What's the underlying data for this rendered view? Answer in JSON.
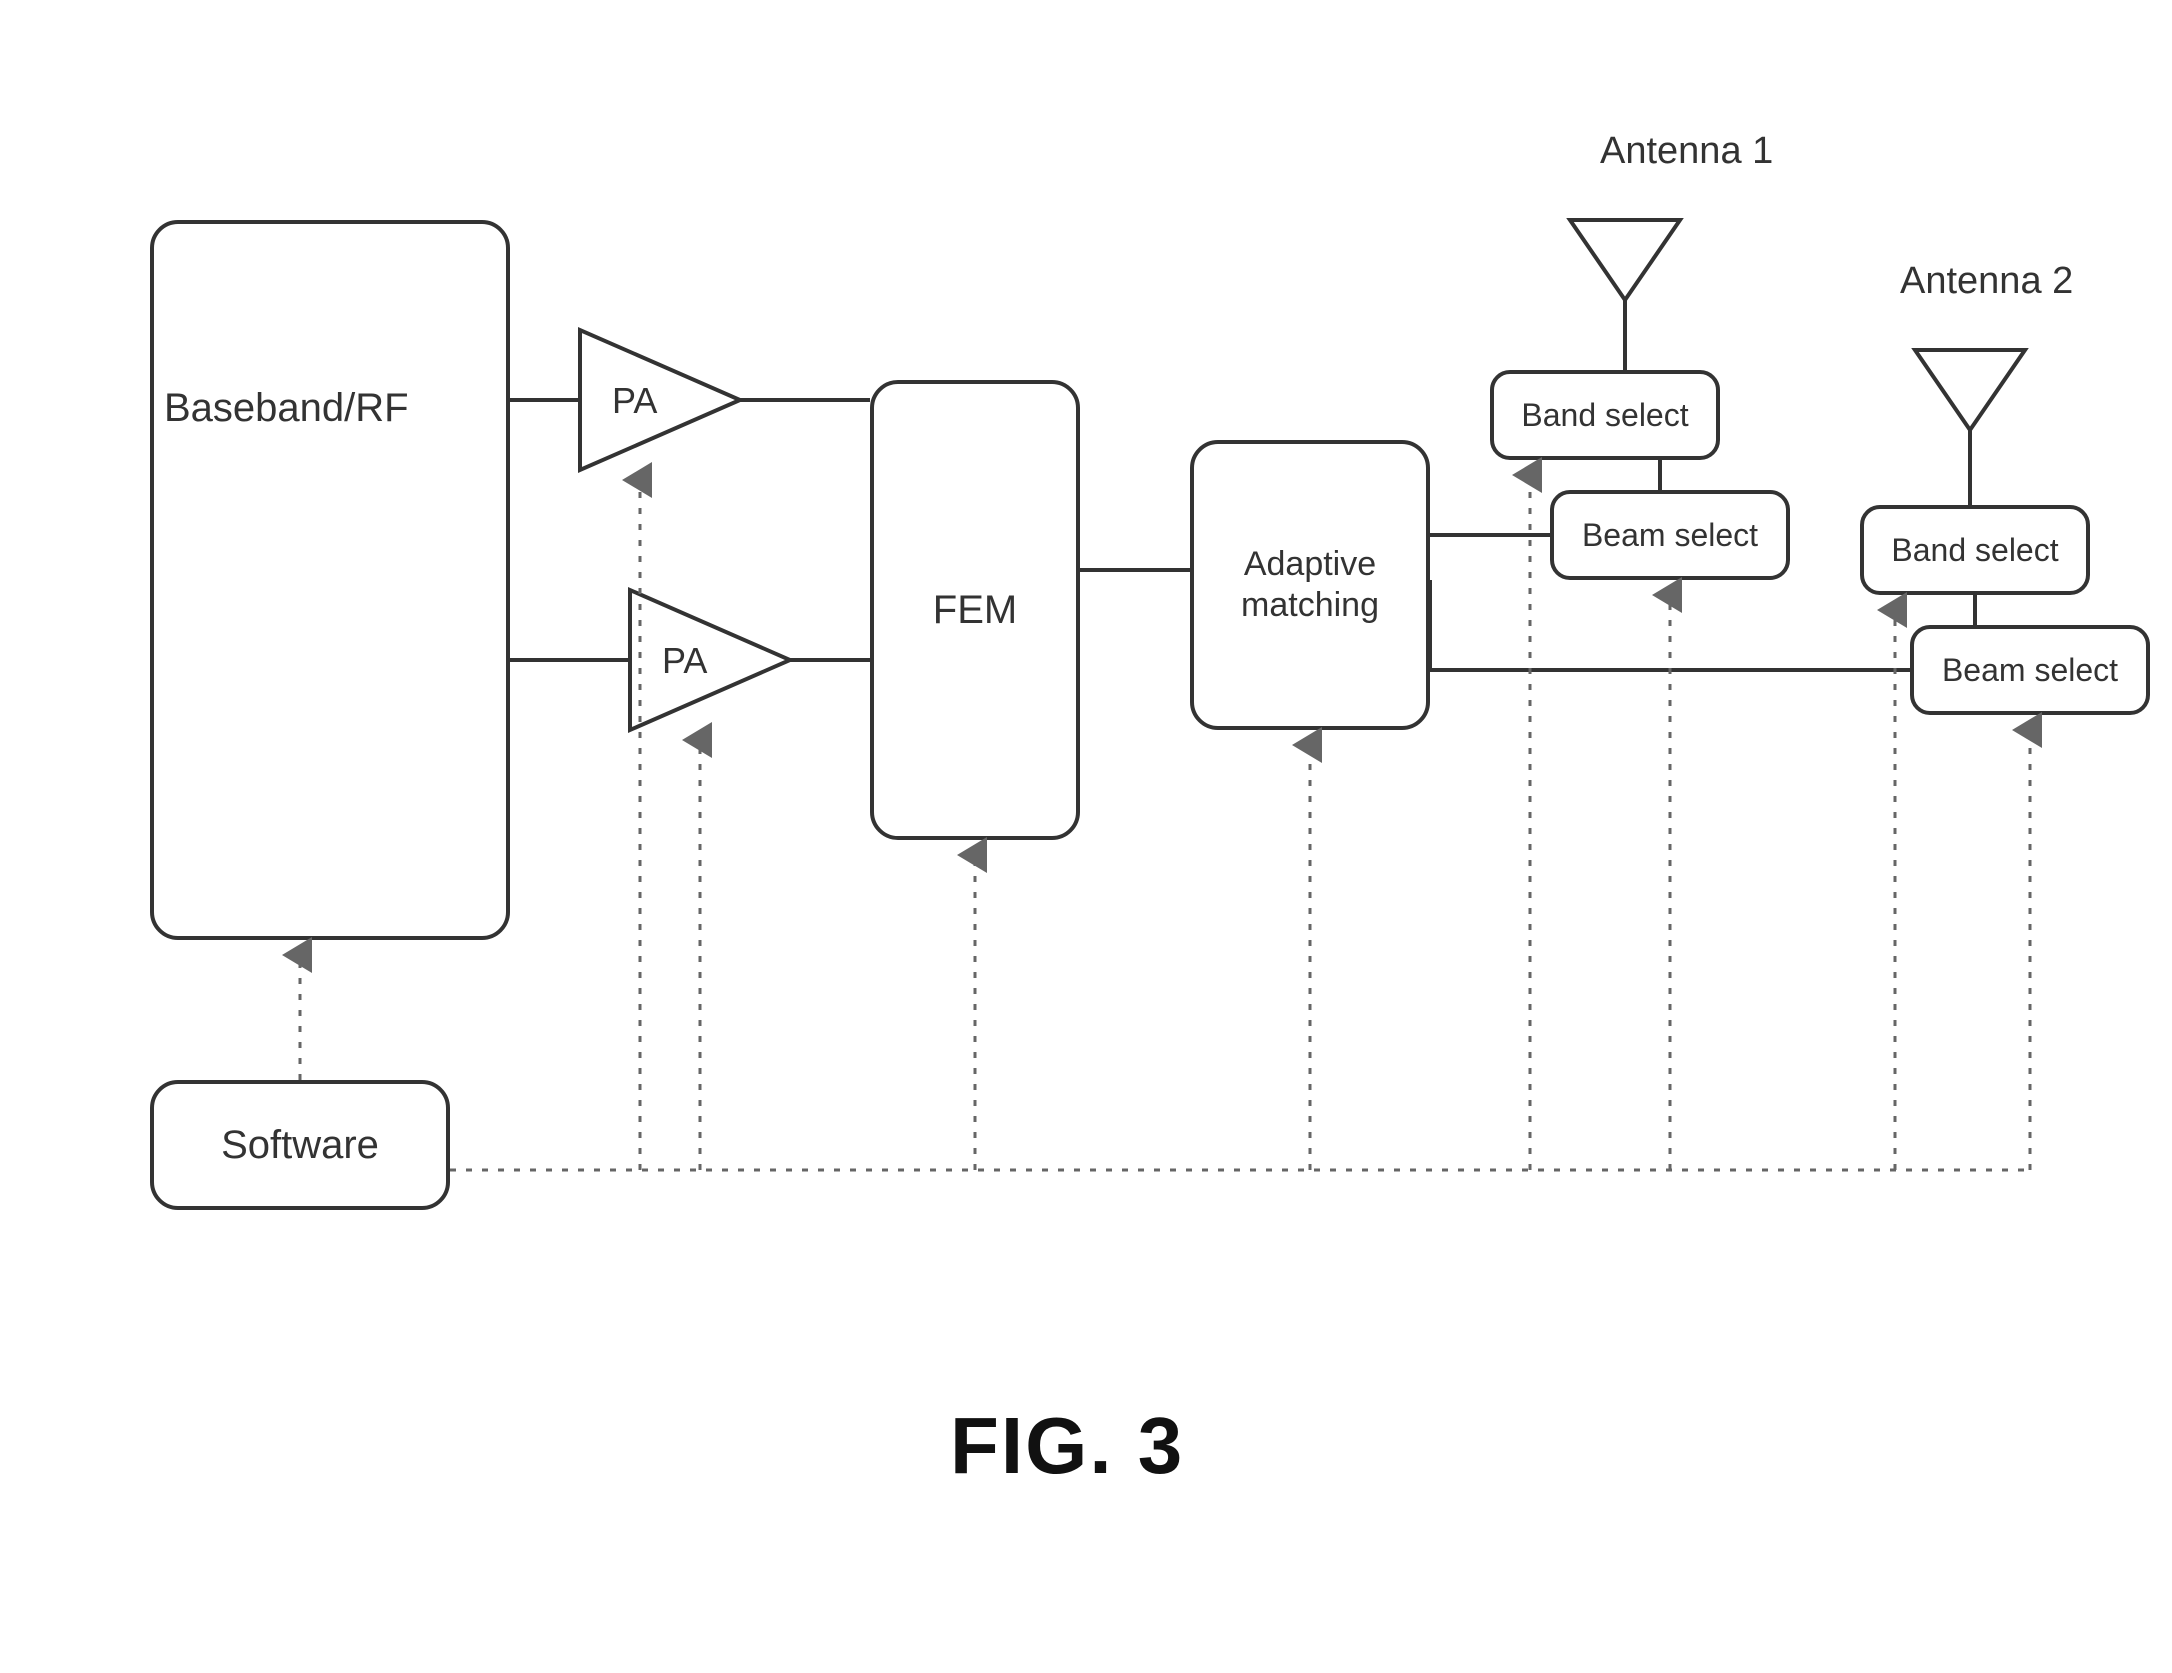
{
  "figure_label": "FIG. 3",
  "blocks": {
    "baseband": "Baseband/RF",
    "software": "Software",
    "pa1": "PA",
    "pa2": "PA",
    "fem": "FEM",
    "adaptive": "Adaptive matching",
    "band_select_1": "Band select",
    "beam_select_1": "Beam select",
    "band_select_2": "Band select",
    "beam_select_2": "Beam select"
  },
  "antennas": {
    "ant1": "Antenna 1",
    "ant2": "Antenna 2"
  },
  "chart_data": {
    "type": "diagram",
    "title": "FIG. 3",
    "nodes": [
      {
        "id": "software",
        "label": "Software",
        "type": "block"
      },
      {
        "id": "baseband",
        "label": "Baseband/RF",
        "type": "block"
      },
      {
        "id": "pa1",
        "label": "PA",
        "type": "amplifier"
      },
      {
        "id": "pa2",
        "label": "PA",
        "type": "amplifier"
      },
      {
        "id": "fem",
        "label": "FEM",
        "type": "block"
      },
      {
        "id": "adaptive",
        "label": "Adaptive matching",
        "type": "block"
      },
      {
        "id": "beam1",
        "label": "Beam select",
        "type": "block"
      },
      {
        "id": "band1",
        "label": "Band select",
        "type": "block"
      },
      {
        "id": "ant1",
        "label": "Antenna 1",
        "type": "antenna"
      },
      {
        "id": "beam2",
        "label": "Beam select",
        "type": "block"
      },
      {
        "id": "band2",
        "label": "Band select",
        "type": "block"
      },
      {
        "id": "ant2",
        "label": "Antenna 2",
        "type": "antenna"
      }
    ],
    "signal_edges": [
      [
        "baseband",
        "pa1"
      ],
      [
        "baseband",
        "pa2"
      ],
      [
        "pa1",
        "fem"
      ],
      [
        "pa2",
        "fem"
      ],
      [
        "fem",
        "adaptive"
      ],
      [
        "adaptive",
        "beam1"
      ],
      [
        "adaptive",
        "beam2"
      ],
      [
        "beam1",
        "band1"
      ],
      [
        "band1",
        "ant1"
      ],
      [
        "beam2",
        "band2"
      ],
      [
        "band2",
        "ant2"
      ]
    ],
    "control_edges": [
      [
        "software",
        "baseband"
      ],
      [
        "software",
        "pa1"
      ],
      [
        "software",
        "pa2"
      ],
      [
        "software",
        "fem"
      ],
      [
        "software",
        "adaptive"
      ],
      [
        "software",
        "band1"
      ],
      [
        "software",
        "beam1"
      ],
      [
        "software",
        "band2"
      ],
      [
        "software",
        "beam2"
      ]
    ]
  }
}
